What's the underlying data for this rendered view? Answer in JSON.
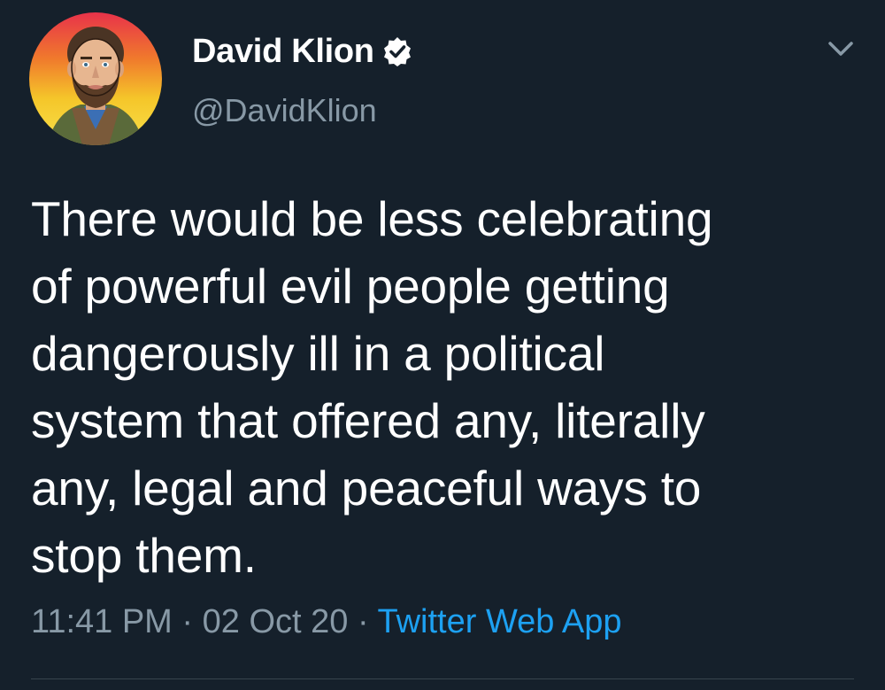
{
  "user": {
    "display_name": "David Klion",
    "handle": "@DavidKlion",
    "verified": true
  },
  "tweet": {
    "text": "There would be less celebrating\nof powerful evil people getting\ndangerously ill in a political\nsystem that offered any, literally\nany, legal and peaceful ways to\nstop them.",
    "time": "11:41 PM",
    "date": "02 Oct 20",
    "source": "Twitter Web App",
    "separator": " · "
  },
  "icons": {
    "verified": "verified-badge-icon",
    "menu": "chevron-down-icon"
  },
  "colors": {
    "background": "#15202b",
    "text": "#ffffff",
    "secondary": "#8899a6",
    "accent": "#1da1f2"
  }
}
